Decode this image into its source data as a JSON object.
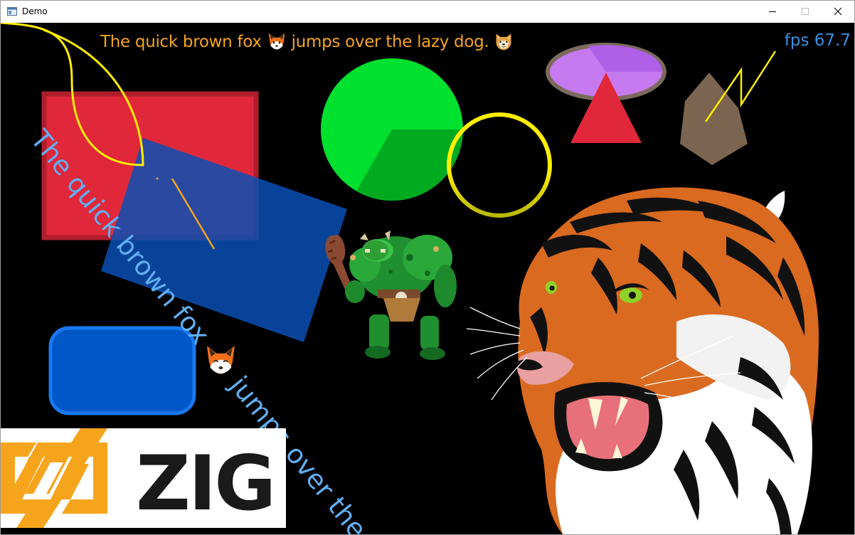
{
  "window": {
    "title": "Demo",
    "icons": {
      "app": "window-app-icon",
      "minimize": "minimize-icon",
      "maximize": "maximize-icon",
      "close": "close-icon"
    }
  },
  "canvas": {
    "background": "#000000",
    "fps_label": "fps 67.7",
    "banner": {
      "text_before_fox": "The quick brown fox ",
      "text_after_fox": " jumps over the lazy dog. ",
      "color": "#f4a51c",
      "emojis": [
        "fox-face-emoji",
        "dog-face-emoji"
      ]
    },
    "diagonal_text": {
      "part1": "The quick brown fox ",
      "part2": " jumps over the",
      "color": "#62aef0",
      "emoji": "fox-face-emoji"
    },
    "shapes": {
      "red_rect": {
        "fill": "#e0283a",
        "stroke": "#b01e2c"
      },
      "blue_rotated_rect": {
        "fill": "#0a4fb4"
      },
      "blue_rounded_rect": {
        "fill": "#0057c8",
        "stroke": "#1978f0"
      },
      "green_circle": {
        "fill": "#00e02e",
        "sector": "#00ab1f"
      },
      "yellow_ring": {
        "stroke": "#ffee00"
      },
      "purple_ellipse": {
        "fill": "#c77af0",
        "stroke": "#7b6a5d"
      },
      "red_triangle": {
        "fill": "#e0283a"
      },
      "brown_polygon": {
        "fill": "#7b6450"
      },
      "lightning_bolt": {
        "stroke": "#ffee00"
      },
      "yellow_curve": {
        "stroke": "#ffee00"
      },
      "orange_line": {
        "stroke": "#f4a51c"
      }
    },
    "images": [
      "orc-sprite",
      "tiger-illustration"
    ],
    "logo": {
      "text": "ZIG",
      "accent": "#f7a41d",
      "text_color": "#1a1a1a"
    }
  }
}
